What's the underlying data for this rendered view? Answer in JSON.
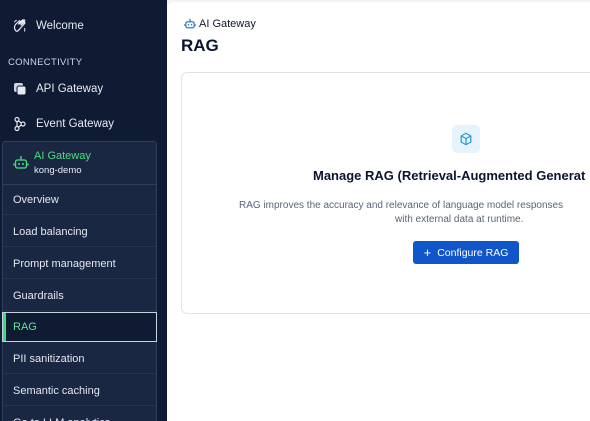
{
  "sidebar": {
    "welcome_label": "Welcome",
    "section_label": "CONNECTIVITY",
    "api_gateway_label": "API Gateway",
    "event_gateway_label": "Event Gateway",
    "ai_gateway": {
      "title": "AI Gateway",
      "subtitle": "kong-demo",
      "items": [
        {
          "label": "Overview"
        },
        {
          "label": "Load balancing"
        },
        {
          "label": "Prompt management"
        },
        {
          "label": "Guardrails"
        },
        {
          "label": "RAG"
        },
        {
          "label": "PII sanitization"
        },
        {
          "label": "Semantic caching"
        },
        {
          "label": "Go to LLM analytics"
        }
      ],
      "active_index": 4
    }
  },
  "main": {
    "breadcrumb": "AI Gateway",
    "title": "RAG",
    "card": {
      "heading": "Manage RAG (Retrieval-Augmented Generat",
      "description_line1": "RAG improves the accuracy and relevance of language model responses",
      "description_line2": "with external data at runtime.",
      "button_label": "Configure RAG"
    }
  },
  "colors": {
    "sidebar_bg": "#0f1a33",
    "accent_green": "#4ade80",
    "primary_button": "#1155cb"
  }
}
